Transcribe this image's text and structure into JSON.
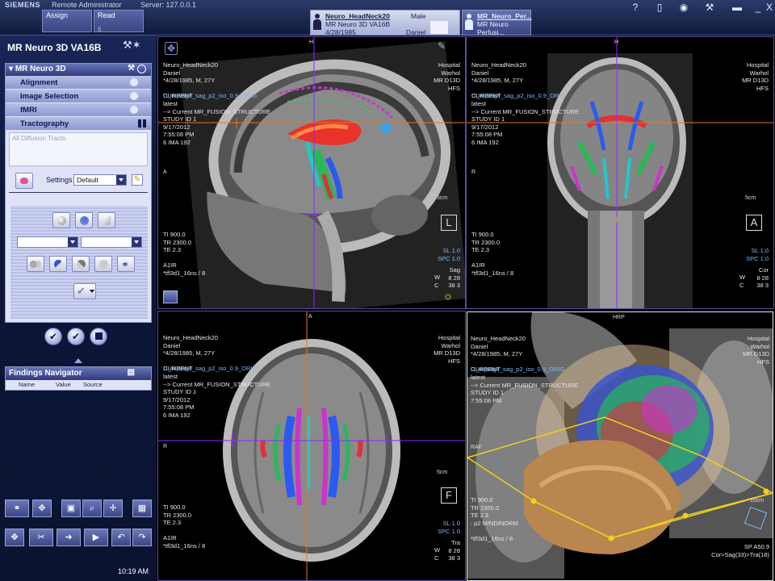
{
  "topbar": {
    "brand": "SIEMENS",
    "user": "Remote Administrator",
    "server": "Server: 127.0.0.1",
    "assign_label": "Assign",
    "read_label": "Read",
    "read_count": "6",
    "patient_tab": {
      "name": "Neuro_HeadNeck20",
      "sex": "Male",
      "study": "MR Neuro 3D VA16B",
      "dob": "4/28/1985",
      "first": "Daniel"
    },
    "second_tab": {
      "name": "MR_Neuro_Per...",
      "study": "MR Neuro Perfusi..."
    },
    "icons": [
      "help-icon",
      "phone-icon",
      "gear-icon",
      "tools-icon",
      "printer-icon",
      "minimize-icon",
      "close-icon"
    ],
    "icon_glyphs": [
      "?",
      "▯",
      "◉",
      "⚒",
      "▬",
      "_",
      "X"
    ]
  },
  "left": {
    "title": "MR Neuro 3D VA16B",
    "card_title": "MR Neuro 3D",
    "menu": [
      {
        "label": "Alignment"
      },
      {
        "label": "Image Selection"
      },
      {
        "label": "fMRI"
      },
      {
        "label": "Tractography"
      }
    ],
    "tracts_label": "All Diffusion Tracts",
    "settings_label": "Settings",
    "settings_value": "Default",
    "findings": {
      "title": "Findings Navigator",
      "cols": [
        "Name",
        "Value",
        "Source"
      ]
    },
    "clock": "10:19 AM"
  },
  "viewports": {
    "sagittal": {
      "tl": "Neuro_HeadNeck20\nDaniel\n*4/28/1985, M, 27Y\n\nCURRENT",
      "tl_blue": "t1_mprage_sag_p2_iso_0.9_ORIG",
      "tl2": "latest\n--> Current MR_FUSION_STRUCTURE\nSTUDY ID 1\n9/17/2012\n7:55:08 PM\n6 IMA 192",
      "tr": "Hospital\nWarhol\nMR D13D\nHFS",
      "bl": "TI 900.0\nTR 2300.0\nTE 2.3\n\nA1IR\n*tfl3d1_16ns / 8",
      "br_blue": "SL 1.0\nSPC 1.0",
      "br": "Sag\n8 28\n38 3",
      "br_wc": "W\nC",
      "top_lbl": "H",
      "left_lbl": "A",
      "scale": "5cm",
      "orient": "L"
    },
    "coronal": {
      "tl": "Neuro_HeadNeck20\nDaniel\n*4/28/1985, M, 27Y\n\nCURRENT",
      "tl_blue": "t1_mprage_sag_p2_iso_0.9_ORIG",
      "tl2": "latest\n--> Current MR_FUSION_STRUCTURE\nSTUDY ID 1\n9/17/2012\n7:55:08 PM\n6 IMA 192",
      "tr": "Hospital\nWarhol\nMR D13D\nHFS",
      "bl": "TI 900.0\nTR 2300.0\nTE 2.3\n\nA1IR\n*tfl3d1_16ns / 8",
      "br_blue": "SL 1.0\nSPC 1.0",
      "br": "Cor\n8 28\n38 3",
      "br_wc": "W\nC",
      "top_lbl": "H",
      "left_lbl": "R",
      "scale": "5cm",
      "orient": "A"
    },
    "axial": {
      "tl": "Neuro_HeadNeck20\nDaniel\n*4/28/1985, M, 27Y\n\nCURRENT",
      "tl_blue": "t1_mprage_sag_p2_iso_0.9_ORIG",
      "tl2": "latest\n--> Current MR_FUSION_STRUCTURE\nSTUDY ID 1\n9/17/2012\n7:55:08 PM\n6 IMA 192",
      "tr": "Hospital\nWarhol\nMR D13D\nHFS",
      "bl": "TI 900.0\nTR 2300.0\nTE 2.3\n\nA1IR\n*tfl3d1_16ns / 8",
      "br_blue": "SL 1.0\nSPC 1.0",
      "br": "Tra\n8 28\n38 3",
      "br_wc": "W\nC",
      "top_lbl": "A",
      "left_lbl": "R",
      "scale": "5cm",
      "orient": "F"
    },
    "volume": {
      "tl": "Neuro_HeadNeck20\nDaniel\n*4/28/1985, M, 27Y\n\nCURRENT",
      "tl_blue": "t1_mprage_sag_p2_iso_0.9_ORIG",
      "tl2": "latest\n--> Current MR_FUSION_STRUCTURE\nSTUDY ID 1\n7:55:08 PM",
      "tr": "Hospital\nWarhol\nMR D13D\nHFS",
      "bl": "TI 900.0\nTR 2300.0\nTE 2.3\n: p2 M/ND/NORM\n\n*tfl3d1_16ns / 8",
      "top_lbl": "HRP",
      "left_lbl": "RAF",
      "scale": "10cm",
      "br": "SP A50.9\nCor>Sag(33)>Tra(18)"
    }
  }
}
